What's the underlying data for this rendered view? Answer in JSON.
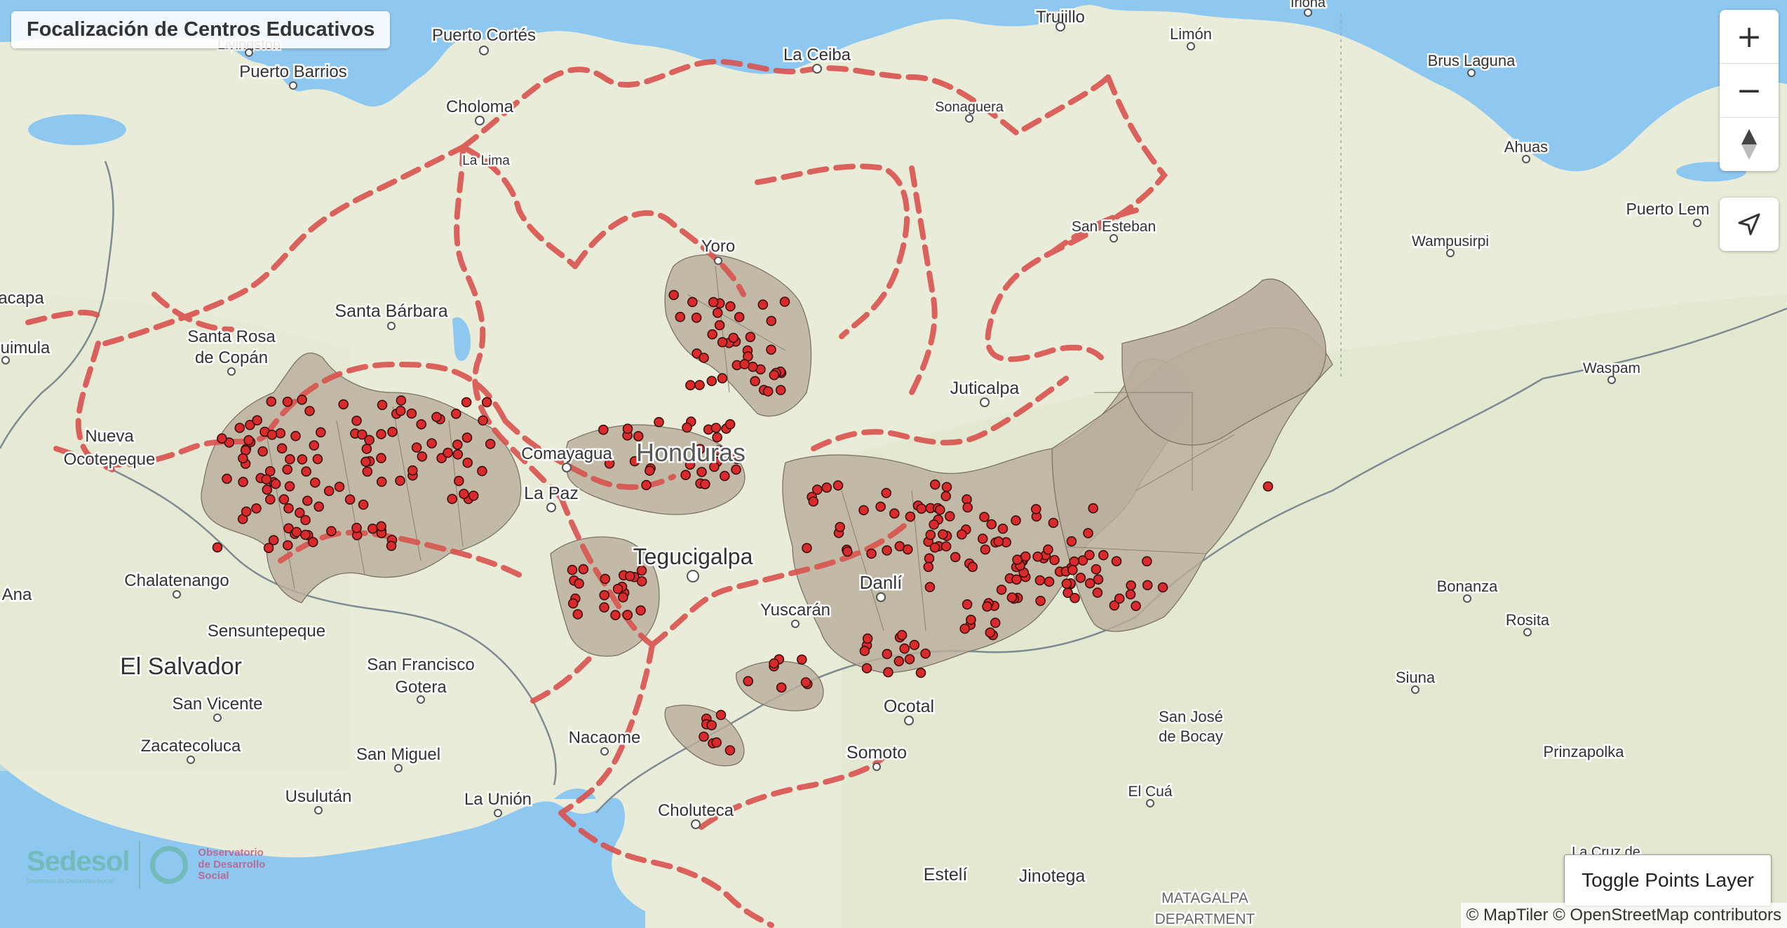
{
  "map": {
    "title": "Focalización de Centros Educativos",
    "controls": {
      "zoom_in": "+",
      "zoom_out": "−",
      "compass": "▲",
      "locate": "➤"
    },
    "toggle_label": "Toggle Points Layer",
    "attribution": {
      "maptiler": "© MapTiler",
      "osm": "© OpenStreetMap contributors"
    },
    "logo": {
      "org": "Sedesol",
      "org_sub": "Secretaría de Desarrollo Social",
      "obs1": "Observatorio",
      "obs2": "de Desarrollo",
      "obs3": "Social"
    },
    "colors": {
      "water": "#8ec8f0",
      "land": "#e9ecd8",
      "route": "#d9534f",
      "municipality": "#b9ad9c",
      "school_point": "#d92b2b"
    },
    "place_labels": [
      {
        "text": "Livingston"
      },
      {
        "text": "Puerto Cortés"
      },
      {
        "text": "Trujillo"
      },
      {
        "text": "Limón"
      },
      {
        "text": "Iriona"
      },
      {
        "text": "Puerto Barrios"
      },
      {
        "text": "La Ceiba"
      },
      {
        "text": "Brus Laguna"
      },
      {
        "text": "Choloma"
      },
      {
        "text": "Sonaguera"
      },
      {
        "text": "La Lima"
      },
      {
        "text": "Ahuas"
      },
      {
        "text": "Yoro"
      },
      {
        "text": "San Esteban"
      },
      {
        "text": "Puerto Lem"
      },
      {
        "text": "Wampusirpi"
      },
      {
        "text": "acapa"
      },
      {
        "text": "Santa Bárbara"
      },
      {
        "text": "uimula"
      },
      {
        "text": "Santa Rosa"
      },
      {
        "text": "de Copán"
      },
      {
        "text": "Juticalpa"
      },
      {
        "text": "Waspam"
      },
      {
        "text": "Nueva"
      },
      {
        "text": "Ocotepeque"
      },
      {
        "text": "Comayagua"
      },
      {
        "text": "Honduras"
      },
      {
        "text": "La Paz"
      },
      {
        "text": "Tegucigalpa"
      },
      {
        "text": "Chalatenango"
      },
      {
        "text": "Danlí"
      },
      {
        "text": "Bonanza"
      },
      {
        "text": "Ana"
      },
      {
        "text": "Sensuntepeque"
      },
      {
        "text": "Yuscarán"
      },
      {
        "text": "Rosita"
      },
      {
        "text": "El Salvador"
      },
      {
        "text": "San Francisco"
      },
      {
        "text": "Gotera"
      },
      {
        "text": "Siuna"
      },
      {
        "text": "San Vicente"
      },
      {
        "text": "Ocotal"
      },
      {
        "text": "San José"
      },
      {
        "text": "de Bocay"
      },
      {
        "text": "Nacaome"
      },
      {
        "text": "Zacatecoluca"
      },
      {
        "text": "San Miguel"
      },
      {
        "text": "Somoto"
      },
      {
        "text": "Prinzapolka"
      },
      {
        "text": "Usulután"
      },
      {
        "text": "La Unión"
      },
      {
        "text": "El Cuá"
      },
      {
        "text": "Choluteca"
      },
      {
        "text": "La Cruz de"
      },
      {
        "text": "Estelí"
      },
      {
        "text": "Jinotega"
      },
      {
        "text": "MATAGALPA"
      },
      {
        "text": "DEPARTMENT"
      }
    ]
  }
}
